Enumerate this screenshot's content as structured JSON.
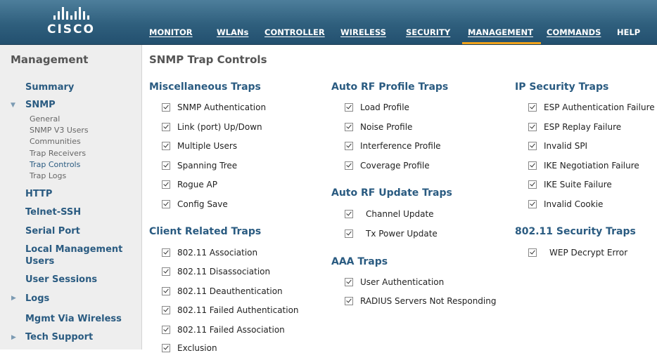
{
  "header": {
    "logo_text": "CISCO",
    "nav": [
      {
        "label": "MONITOR"
      },
      {
        "label": "WLANs"
      },
      {
        "label": "CONTROLLER"
      },
      {
        "label": "WIRELESS"
      },
      {
        "label": "SECURITY"
      },
      {
        "label": "MANAGEMENT",
        "active": true
      },
      {
        "label": "COMMANDS"
      },
      {
        "label": "HELP"
      }
    ],
    "active_accent": "#f1a21b"
  },
  "sidebar": {
    "title": "Management",
    "items": {
      "summary": "Summary",
      "snmp": "SNMP",
      "http": "HTTP",
      "telnet": "Telnet-SSH",
      "serial": "Serial Port",
      "local_mgmt_1": "Local Management",
      "local_mgmt_2": "Users",
      "sessions": "User Sessions",
      "logs": "Logs",
      "mgmt_wireless": "Mgmt Via Wireless",
      "tech": "Tech Support"
    },
    "snmp_sub": {
      "general": "General",
      "v3": "SNMP V3 Users",
      "communities": "Communities",
      "receivers": "Trap Receivers",
      "controls": "Trap Controls",
      "logs": "Trap Logs"
    }
  },
  "main": {
    "title": "SNMP Trap Controls",
    "misc": {
      "title": "Miscellaneous Traps",
      "items": [
        "SNMP Authentication",
        "Link (port) Up/Down",
        "Multiple Users",
        "Spanning Tree",
        "Rogue AP",
        "Config Save"
      ]
    },
    "client": {
      "title": "Client Related Traps",
      "items": [
        "802.11 Association",
        "802.11 Disassociation",
        "802.11 Deauthentication",
        "802.11 Failed Authentication",
        "802.11 Failed Association",
        "Exclusion"
      ]
    },
    "rf_profile": {
      "title": "Auto RF Profile Traps",
      "items": [
        "Load Profile",
        "Noise Profile",
        "Interference Profile",
        "Coverage Profile"
      ]
    },
    "rf_update": {
      "title": "Auto RF Update Traps",
      "items": [
        "Channel Update",
        "Tx Power Update"
      ]
    },
    "aaa": {
      "title": "AAA Traps",
      "items": [
        "User Authentication",
        "RADIUS Servers Not Responding"
      ]
    },
    "ipsec": {
      "title": "IP Security Traps",
      "items": [
        "ESP Authentication Failure",
        "ESP Replay Failure",
        "Invalid SPI",
        "IKE Negotiation Failure",
        "IKE Suite Failure",
        "Invalid Cookie"
      ]
    },
    "dot11sec": {
      "title": "802.11 Security Traps",
      "items": [
        "WEP Decrypt Error"
      ]
    }
  }
}
